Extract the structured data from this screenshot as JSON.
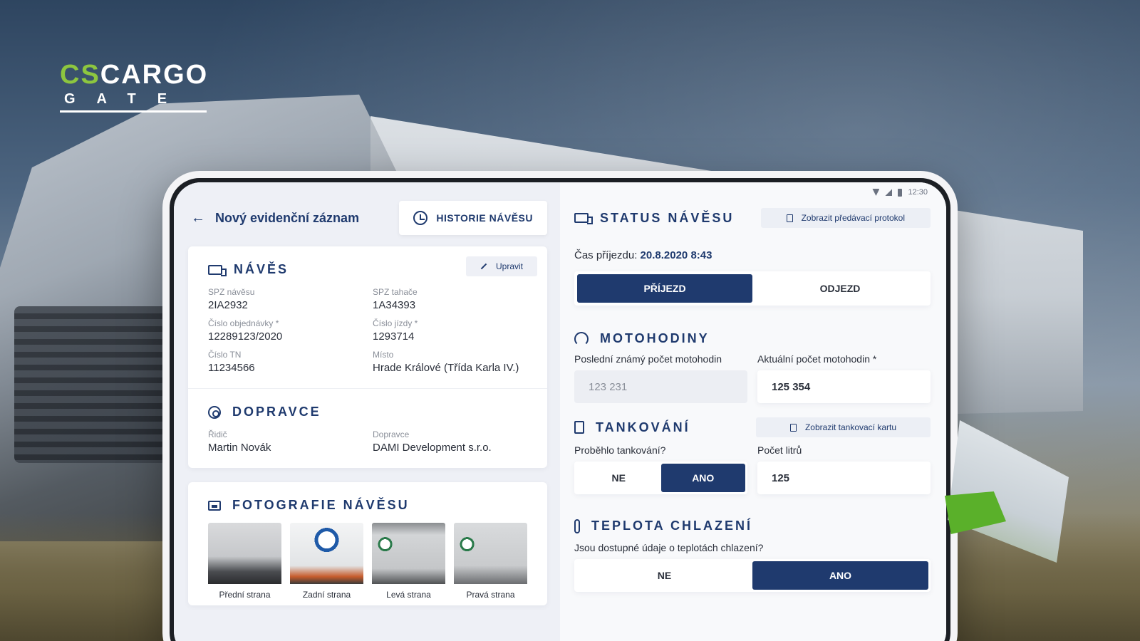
{
  "brand": {
    "logo_top_cs": "CS",
    "logo_top_rest": "CARGO",
    "logo_bottom": "GATE"
  },
  "status_bar": {
    "time": "12:30"
  },
  "header": {
    "title": "Nový evidenční záznam",
    "history_button": "HISTORIE NÁVĚSU"
  },
  "naves": {
    "title": "NÁVĚS",
    "edit_label": "Upravit",
    "fields": [
      {
        "label": "SPZ návěsu",
        "value": "2IA2932"
      },
      {
        "label": "SPZ tahače",
        "value": "1A34393"
      },
      {
        "label": "Číslo objednávky *",
        "value": "12289123/2020"
      },
      {
        "label": "Číslo jízdy *",
        "value": "1293714"
      },
      {
        "label": "Číslo TN",
        "value": "11234566"
      },
      {
        "label": "Místo",
        "value": "Hrade Králové (Třída Karla IV.)"
      }
    ]
  },
  "dopravce": {
    "title": "DOPRAVCE",
    "fields": [
      {
        "label": "Řidič",
        "value": "Martin Novák"
      },
      {
        "label": "Dopravce",
        "value": "DAMI Development s.r.o."
      }
    ]
  },
  "photos": {
    "title": "FOTOGRAFIE NÁVĚSU",
    "items": [
      {
        "caption": "Přední strana"
      },
      {
        "caption": "Zadní strana"
      },
      {
        "caption": "Levá strana"
      },
      {
        "caption": "Pravá strana"
      }
    ]
  },
  "status": {
    "title_a": "STATUS",
    "title_b": "NÁVĚSU",
    "protocol_link": "Zobrazit předávací protokol",
    "arrival_label": "Čas příjezdu:",
    "arrival_value": "20.8.2020 8:43",
    "options": [
      "PŘÍJEZD",
      "ODJEZD"
    ],
    "selected": "PŘÍJEZD"
  },
  "motohodiny": {
    "title": "MOTOHODINY",
    "last_label": "Poslední známý počet motohodin",
    "last_value": "123 231",
    "current_label": "Aktuální počet motohodin *",
    "current_value": "125 354"
  },
  "tankovani": {
    "title": "TANKOVÁNÍ",
    "card_link": "Zobrazit tankovací kartu",
    "question": "Proběhlo tankování?",
    "options": [
      "NE",
      "ANO"
    ],
    "selected": "ANO",
    "liters_label": "Počet litrů",
    "liters_value": "125"
  },
  "teplota": {
    "title": "TEPLOTA CHLAZENÍ",
    "question": "Jsou dostupné údaje o teplotách chlazení?",
    "options": [
      "NE",
      "ANO"
    ],
    "selected": "ANO"
  },
  "colors": {
    "primary": "#1f3a6e",
    "accent_green": "#8dc63f"
  }
}
